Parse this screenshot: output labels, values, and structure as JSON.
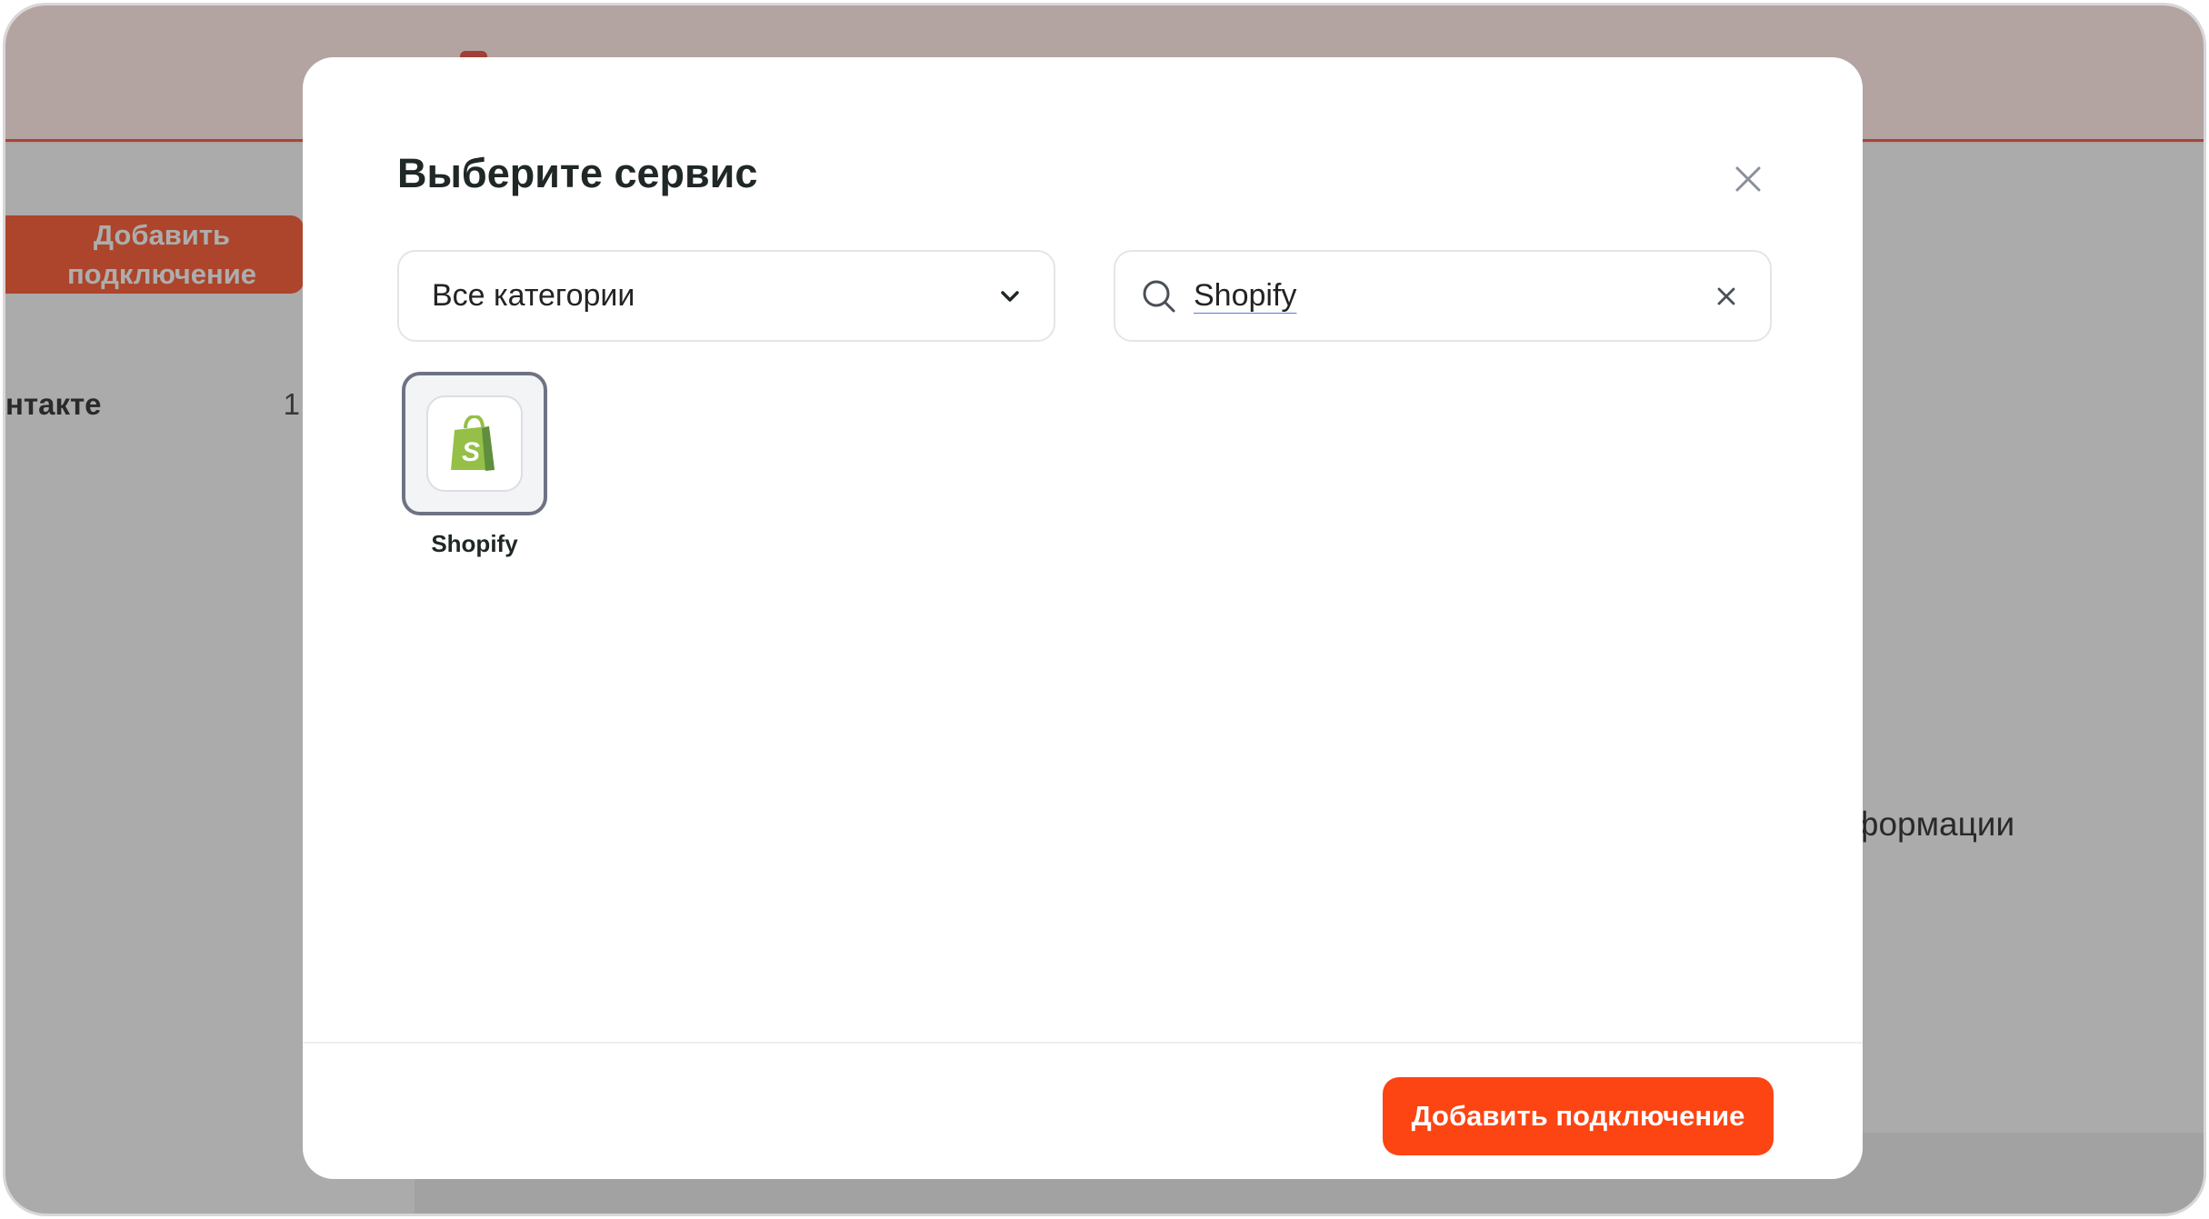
{
  "background": {
    "side_button_label": "Добавить подключение",
    "side_row_label": "нтакте",
    "side_row_count": "1",
    "right_text": "формации"
  },
  "modal": {
    "title": "Выберите сервис",
    "category_select": {
      "selected": "Все категории"
    },
    "search": {
      "value": "Shopify"
    },
    "services": [
      {
        "label": "Shopify",
        "icon": "shopify-bag-icon",
        "selected": true
      }
    ],
    "footer": {
      "add_button_label": "Добавить подключение"
    }
  },
  "colors": {
    "accent": "#fd4413",
    "shopify_green": "#95bf47",
    "selected_border": "#6e7384"
  }
}
